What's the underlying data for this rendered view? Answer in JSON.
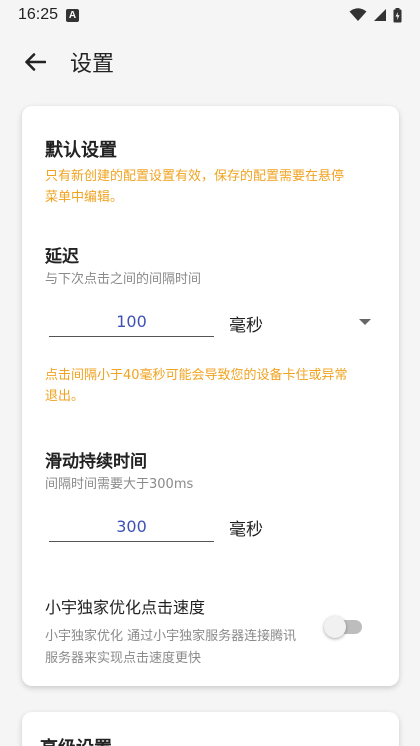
{
  "status_bar": {
    "time": "16:25",
    "a_badge": "A"
  },
  "app_bar": {
    "title": "设置"
  },
  "default_section": {
    "title": "默认设置",
    "warning_line1": "只有新创建的配置设置有效，保存的配置需要在悬停",
    "warning_line2": "菜单中编辑。"
  },
  "delay": {
    "title": "延迟",
    "hint": "与下次点击之间的间隔时间",
    "value": "100",
    "unit": "毫秒",
    "warning_line1": "点击间隔小于40毫秒可能会导致您的设备卡住或异常",
    "warning_line2": "退出。"
  },
  "swipe": {
    "title": "滑动持续时间",
    "hint": "间隔时间需要大于300ms",
    "value": "300",
    "unit": "毫秒"
  },
  "optimize": {
    "title": "小宇独家优化点击速度",
    "desc_line1": "小宇独家优化  通过小宇独家服务器连接腾讯",
    "desc_line2": "服务器来实现点击速度更快",
    "enabled": false
  },
  "advanced_section": {
    "title": "高级设置"
  },
  "colors": {
    "warning": "#f0a320",
    "field_value": "#3f51b5",
    "hint": "#8a8a8a"
  }
}
